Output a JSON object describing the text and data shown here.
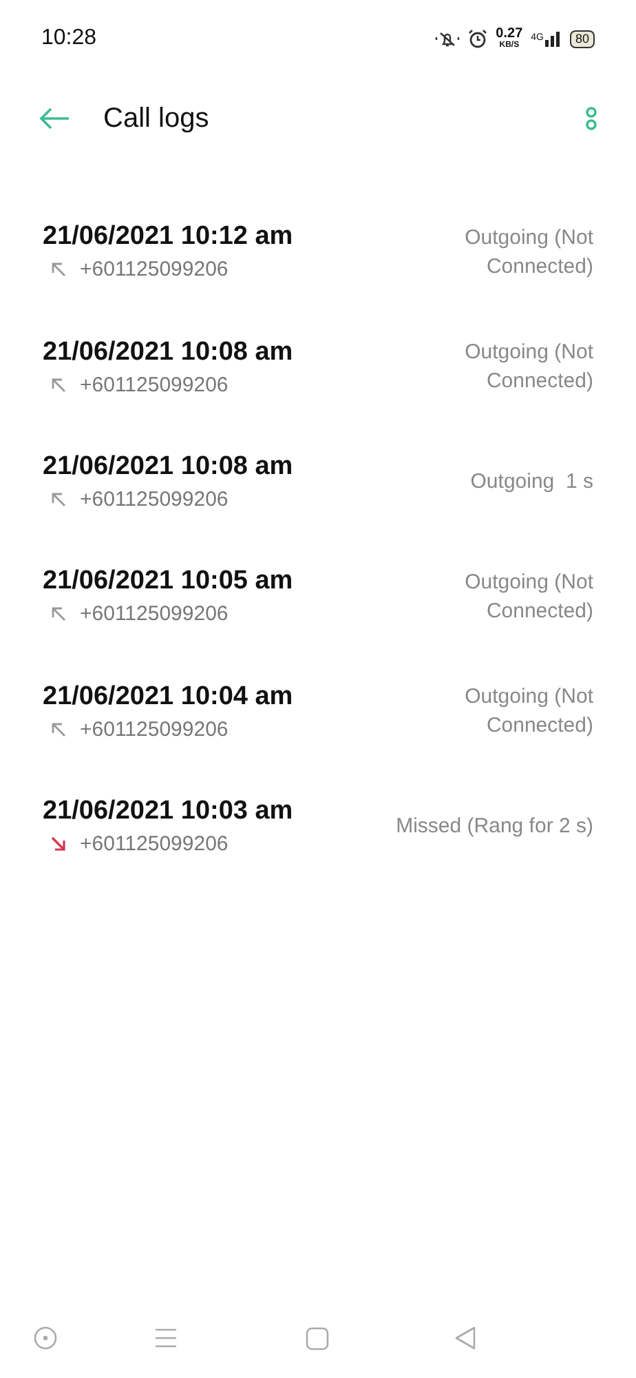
{
  "status_bar": {
    "time": "10:28",
    "speed": "0.27",
    "speed_unit": "KB/S",
    "network": "4G",
    "battery": "80"
  },
  "app_bar": {
    "title": "Call logs"
  },
  "calls": [
    {
      "datetime": "21/06/2021 10:12 am",
      "kind": "outgoing",
      "number": "+601125099206",
      "status": "Outgoing (Not Connected)"
    },
    {
      "datetime": "21/06/2021 10:08 am",
      "kind": "outgoing",
      "number": "+601125099206",
      "status": "Outgoing (Not Connected)"
    },
    {
      "datetime": "21/06/2021 10:08 am",
      "kind": "outgoing",
      "number": "+601125099206",
      "status": "Outgoing  1 s"
    },
    {
      "datetime": "21/06/2021 10:05 am",
      "kind": "outgoing",
      "number": "+601125099206",
      "status": "Outgoing (Not Connected)"
    },
    {
      "datetime": "21/06/2021 10:04 am",
      "kind": "outgoing",
      "number": "+601125099206",
      "status": "Outgoing (Not Connected)"
    },
    {
      "datetime": "21/06/2021 10:03 am",
      "kind": "missed",
      "number": "+601125099206",
      "status": "Missed (Rang for 2 s)"
    }
  ]
}
